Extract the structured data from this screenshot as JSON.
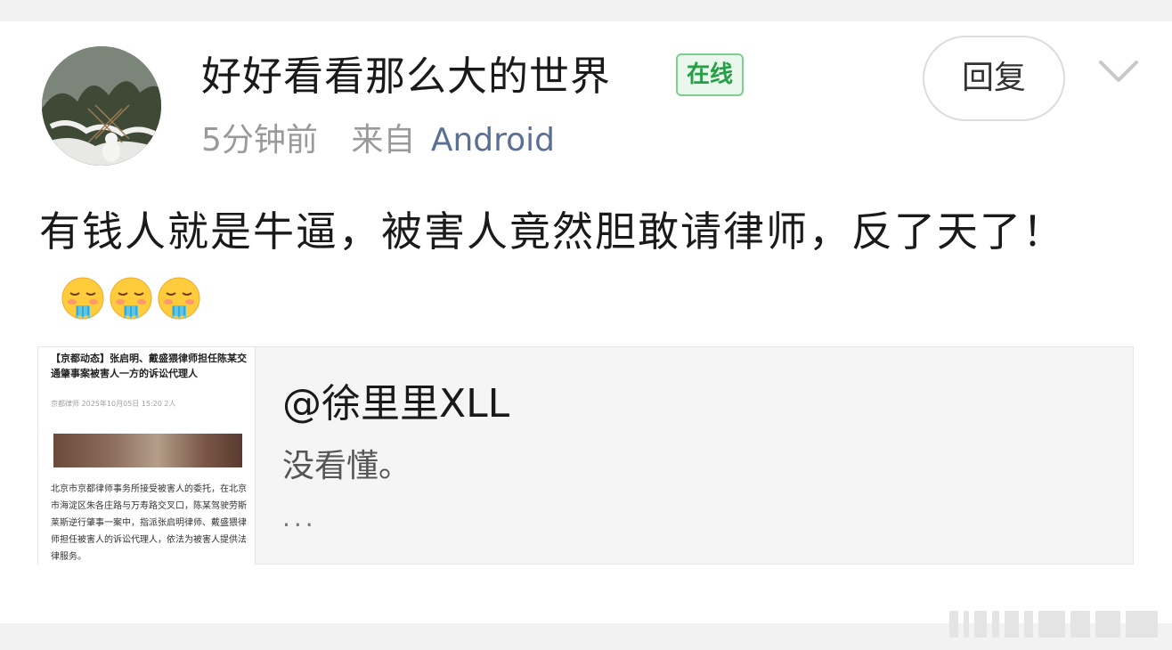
{
  "post": {
    "username": "好好看看那么大的世界",
    "online_badge": "在线",
    "time": "5分钟前",
    "from_prefix": "来自",
    "source": "Android",
    "reply_label": "回复",
    "content_text": "有钱人就是牛逼，被害人竟然胆敢请律师，反了天了！",
    "emojis": [
      "steam-from-nose-emoji",
      "steam-from-nose-emoji",
      "steam-from-nose-emoji"
    ]
  },
  "quote": {
    "user": "@徐里里XLL",
    "text": "没看懂。",
    "more": "...",
    "thumbnail": {
      "headline": "【京都动态】张启明、戴盛猥律师担任陈某交通肇事案被害人一方的诉讼代理人",
      "meta": "京都律师  2025年10月05日 15:20  2人",
      "body": "北京市京都律师事务所接受被害人的委托，在北京市海淀区朱各庄路与万寿路交叉口，陈某驾驶劳斯莱斯逆行肇事一案中，指派张启明律师、戴盛猥律师担任被害人的诉讼代理人，依法为被害人提供法律服务。"
    }
  },
  "colors": {
    "online_green": "#25a046",
    "source_blue": "#5a6f93",
    "meta_gray": "#9a9a9a"
  }
}
